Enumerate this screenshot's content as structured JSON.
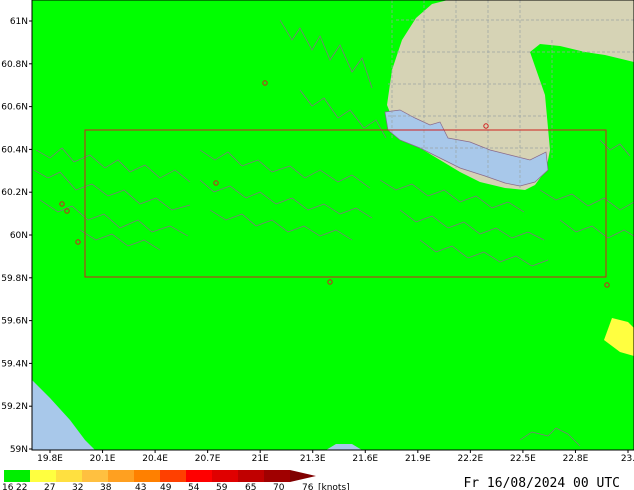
{
  "map": {
    "lat_labels": [
      "61N",
      "60.8N",
      "60.6N",
      "60.4N",
      "60.2N",
      "60N",
      "59.8N",
      "59.6N",
      "59.4N",
      "59.2N",
      "59N"
    ],
    "lon_labels": [
      "19.8E",
      "20.1E",
      "20.4E",
      "20.7E",
      "21E",
      "21.3E",
      "21.6E",
      "21.9E",
      "22.2E",
      "22.5E",
      "22.8E",
      "23."
    ],
    "colors": {
      "wind_16_22": "#00ff00",
      "land": "#d6d3b5",
      "water": "#a8c8ea",
      "coast": "#8a6a8a",
      "grid": "#9aa4a4",
      "domain_box": "#d02020",
      "wind_22_27": "#ffff40"
    }
  },
  "legend": {
    "labels": [
      "16",
      "22",
      "27",
      "32",
      "38",
      "43",
      "49",
      "54",
      "59",
      "65",
      "70",
      "76"
    ],
    "unit": "[knots]",
    "colors": [
      "#00ee00",
      "#ffff40",
      "#ffe040",
      "#ffc040",
      "#ffa020",
      "#ff8000",
      "#ff4000",
      "#ff0000",
      "#e00000",
      "#c00000",
      "#a00000",
      "#800000"
    ]
  },
  "timestamp": "Fr 16/08/2024 00 UTC"
}
